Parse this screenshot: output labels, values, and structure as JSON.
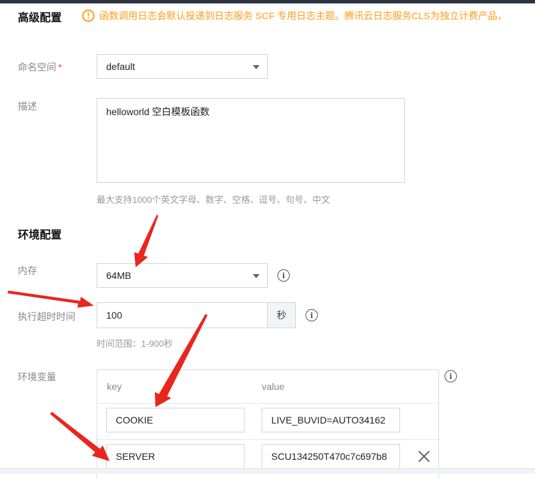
{
  "advanced": {
    "title": "高级配置",
    "notice": "函数调用日志会默认投递到日志服务 SCF 专用日志主题。腾讯云日志服务CLS为独立计费产品，"
  },
  "namespace": {
    "label": "命名空间",
    "required_mark": "*",
    "value": "default"
  },
  "description": {
    "label": "描述",
    "value": "helloworld 空白模板函数",
    "hint": "最大支持1000个英文字母、数字、空格、逗号、句号、中文"
  },
  "env_config": {
    "title": "环境配置",
    "memory": {
      "label": "内存",
      "value": "64MB"
    },
    "timeout": {
      "label": "执行超时时间",
      "value": "100",
      "unit": "秒",
      "hint": "时间范围：1-900秒"
    },
    "env_vars": {
      "label": "环境变量",
      "columns": [
        "key",
        "value"
      ],
      "rows": [
        {
          "key": "COOKIE",
          "value": "LIVE_BUVID=AUTO34162"
        },
        {
          "key": "SERVER",
          "value": "SCU134250T470c7c697b8"
        }
      ]
    }
  },
  "annotation_color": "#e8261c",
  "accent_warning": "#ff9c19"
}
